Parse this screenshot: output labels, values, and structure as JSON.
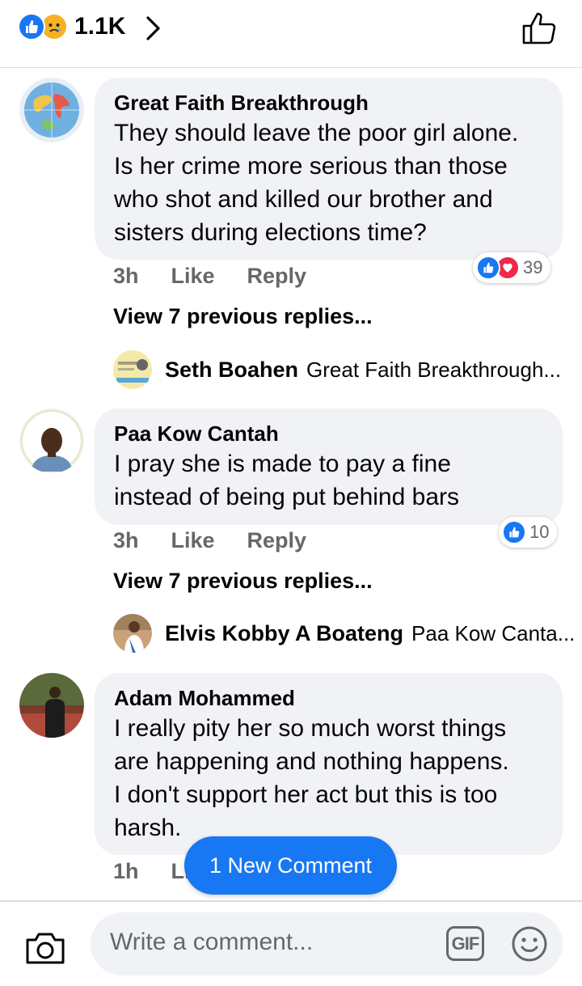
{
  "header": {
    "reaction_icons": [
      "like-icon",
      "sad-icon"
    ],
    "reaction_count": "1.1K",
    "chevron_icon": "chevron-right-icon",
    "like_button_icon": "thumbs-up-outline-icon"
  },
  "comments": [
    {
      "author": "Great Faith Breakthrough",
      "lines": [
        "They should leave the poor girl alone.",
        "Is her crime more serious than those",
        "who shot and killed our brother and",
        "sisters during elections time?"
      ],
      "time": "3h",
      "like_label": "Like",
      "reply_label": "Reply",
      "reactions": [
        "like-icon",
        "love-icon"
      ],
      "reaction_count": "39",
      "view_previous": "View 7 previous replies...",
      "last_reply": {
        "name": "Seth Boahen",
        "snippet": "Great Faith Breakthrough..."
      }
    },
    {
      "author": "Paa Kow Cantah",
      "lines": [
        "I pray she is made to pay a fine",
        "instead of being put behind bars"
      ],
      "time": "3h",
      "like_label": "Like",
      "reply_label": "Reply",
      "reactions": [
        "like-icon"
      ],
      "reaction_count": "10",
      "view_previous": "View 7 previous replies...",
      "last_reply": {
        "name": "Elvis Kobby A Boateng",
        "snippet": "Paa Kow Canta..."
      }
    },
    {
      "author": "Adam Mohammed",
      "lines": [
        "I really pity her so much worst things",
        "are happening and nothing happens.",
        "I don't support her act but this is too",
        "harsh."
      ],
      "time": "1h",
      "like_label": "Li"
    }
  ],
  "new_comment_pill": "1 New Comment",
  "composer": {
    "placeholder": "Write a comment...",
    "camera_icon": "camera-icon",
    "gif_label": "GIF",
    "emoji_icon": "smiley-icon"
  },
  "colors": {
    "accent": "#1877f2",
    "bubble": "#f0f2f5",
    "meta_text": "#65676b",
    "love": "#f02849",
    "sad": "#f7b125"
  }
}
